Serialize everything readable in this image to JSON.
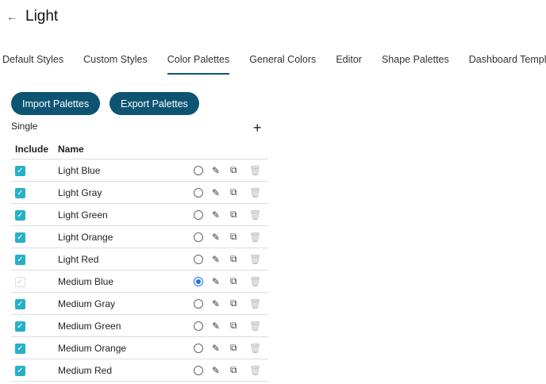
{
  "header": {
    "title": "Light"
  },
  "tabs": [
    "Default Styles",
    "Custom Styles",
    "Color Palettes",
    "General Colors",
    "Editor",
    "Shape Palettes",
    "Dashboard Templates"
  ],
  "active_tab": "Color Palettes",
  "buttons": {
    "import": "Import Palettes",
    "export": "Export Palettes"
  },
  "section": "Single",
  "table": {
    "headers": {
      "include": "Include",
      "name": "Name"
    },
    "rows": [
      {
        "name": "Light Blue",
        "include": true,
        "selected": false
      },
      {
        "name": "Light Gray",
        "include": true,
        "selected": false
      },
      {
        "name": "Light Green",
        "include": true,
        "selected": false
      },
      {
        "name": "Light Orange",
        "include": true,
        "selected": false
      },
      {
        "name": "Light Red",
        "include": true,
        "selected": false
      },
      {
        "name": "Medium Blue",
        "include": true,
        "selected": true,
        "disabled": true
      },
      {
        "name": "Medium Gray",
        "include": true,
        "selected": false
      },
      {
        "name": "Medium Green",
        "include": true,
        "selected": false
      },
      {
        "name": "Medium Orange",
        "include": true,
        "selected": false
      },
      {
        "name": "Medium Red",
        "include": true,
        "selected": false
      }
    ]
  },
  "colors": {
    "primary": "#0d5472",
    "checkbox": "#26b0c7",
    "radio": "#1a73e8"
  }
}
